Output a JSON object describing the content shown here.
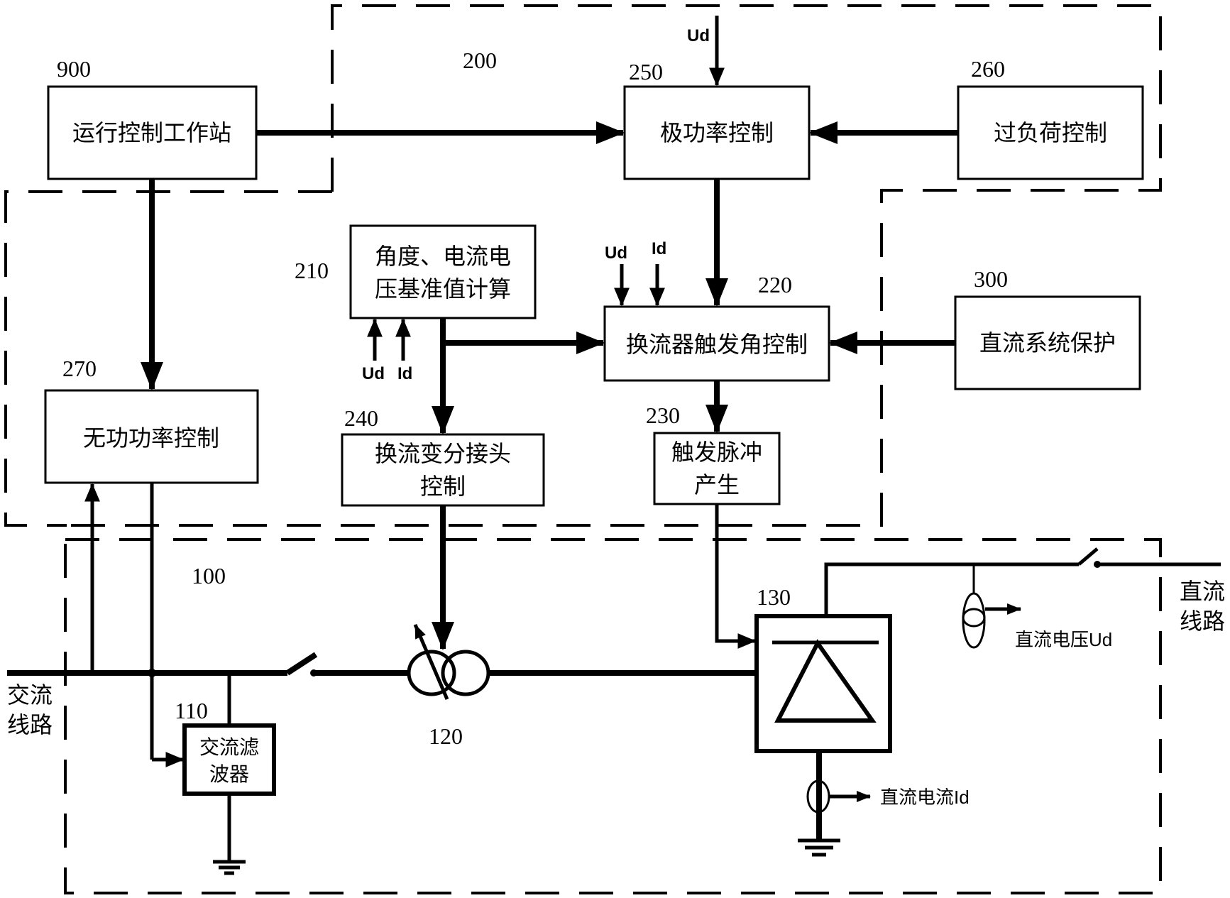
{
  "regions": {
    "r200": "200",
    "r100": "100"
  },
  "blocks": {
    "b900": {
      "id": "900",
      "label": "运行控制工作站"
    },
    "b250": {
      "id": "250",
      "label": "极功率控制"
    },
    "b260": {
      "id": "260",
      "label": "过负荷控制"
    },
    "b210": {
      "id": "210",
      "line1": "角度、电流电",
      "line2": "压基准值计算"
    },
    "b220": {
      "id": "220",
      "label": "换流器触发角控制"
    },
    "b300": {
      "id": "300",
      "label": "直流系统保护"
    },
    "b270": {
      "id": "270",
      "label": "无功功率控制"
    },
    "b240": {
      "id": "240",
      "line1": "换流变分接头",
      "line2": "控制"
    },
    "b230": {
      "id": "230",
      "line1": "触发脉冲",
      "line2": "产生"
    },
    "b110": {
      "id": "110",
      "line1": "交流滤",
      "line2": "波器"
    }
  },
  "components": {
    "transformer": {
      "id": "120"
    },
    "converter": {
      "id": "130"
    }
  },
  "signals": {
    "ud": "Ud",
    "id": "Id"
  },
  "labels": {
    "ac_line_1": "交流",
    "ac_line_2": "线路",
    "dc_line_1": "直流",
    "dc_line_2": "线路",
    "dc_voltage": "直流电压Ud",
    "dc_current": "直流电流Id"
  }
}
